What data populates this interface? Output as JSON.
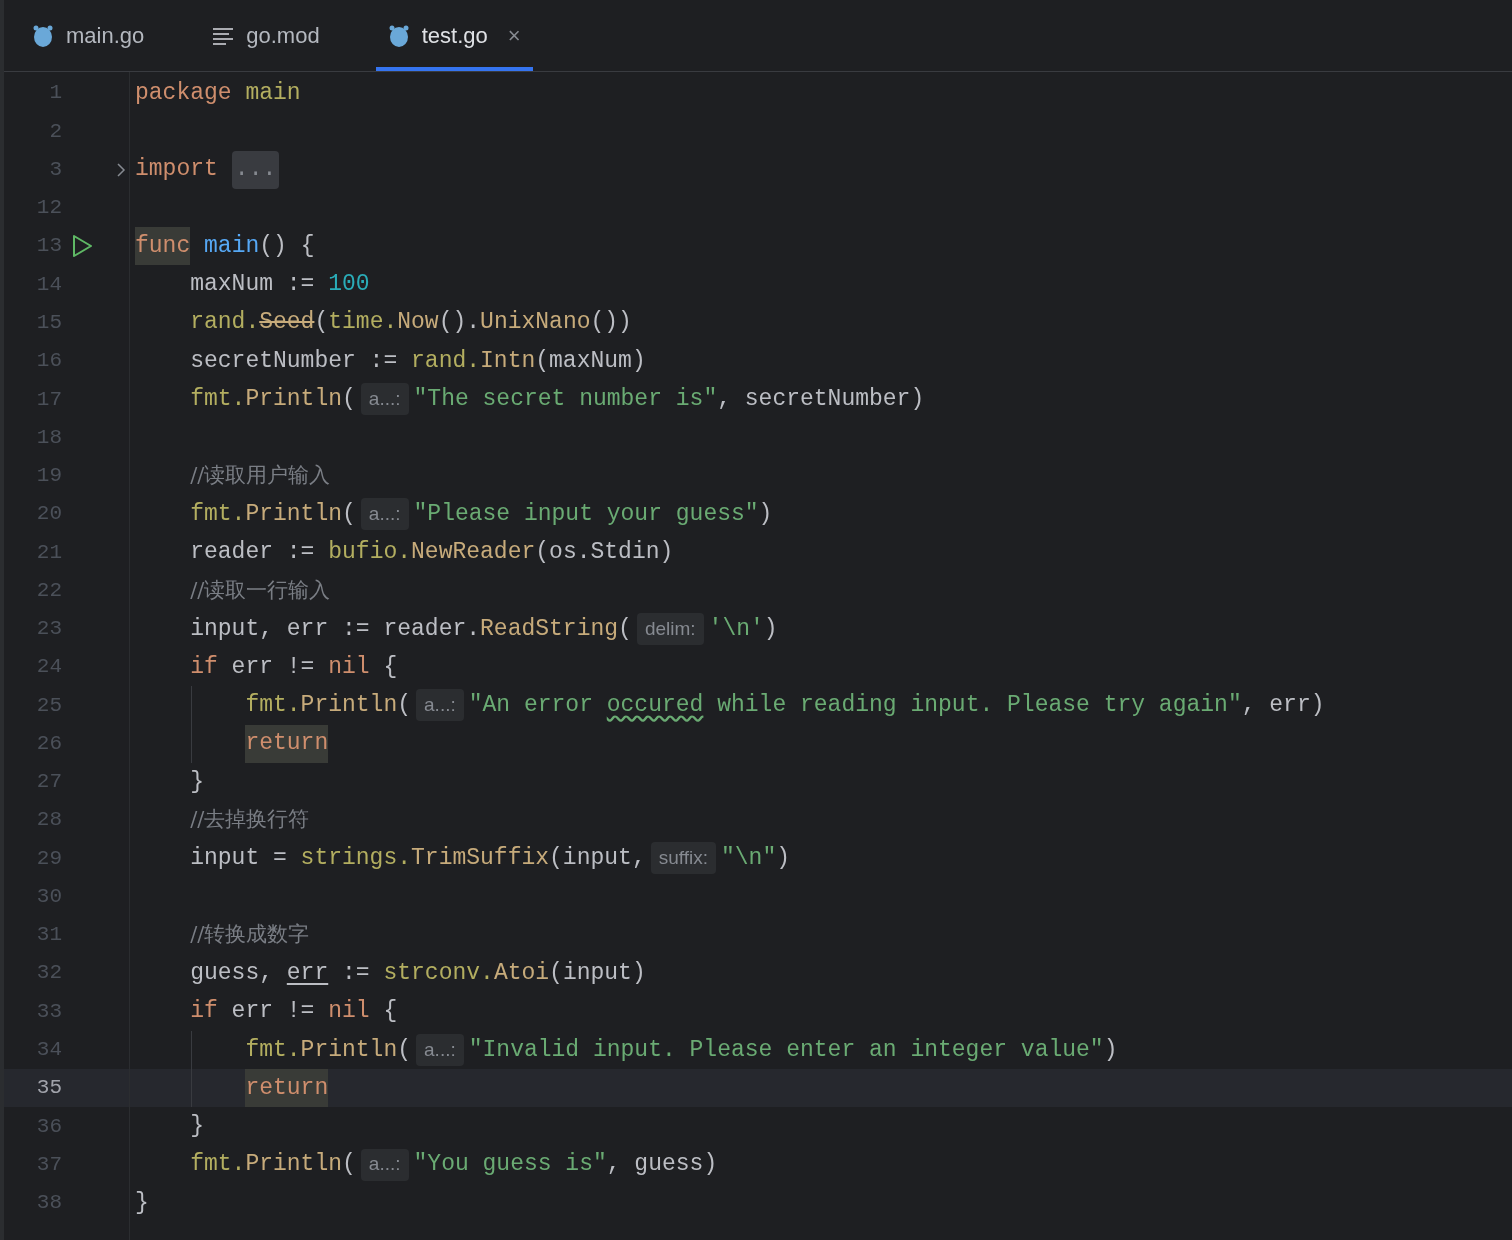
{
  "tabs": [
    {
      "label": "main.go",
      "kind": "go",
      "selected": false,
      "closable": false
    },
    {
      "label": "go.mod",
      "kind": "text",
      "selected": false,
      "closable": false
    },
    {
      "label": "test.go",
      "kind": "go",
      "selected": true,
      "closable": true,
      "close": "×"
    }
  ],
  "lines": [
    {
      "number": "1",
      "current": false,
      "folded": false,
      "runnable": false,
      "tokens": [
        {
          "kind": "keyword",
          "text": "package"
        },
        {
          "kind": "pkg",
          "text": " main"
        }
      ]
    },
    {
      "number": "2",
      "current": false,
      "folded": false,
      "runnable": false
    },
    {
      "number": "3",
      "current": false,
      "folded": true,
      "runnable": false,
      "tokens": [
        {
          "kind": "keyword",
          "text": "import"
        },
        {
          "kind": "fold",
          "text": "..."
        }
      ]
    },
    {
      "number": "12",
      "current": false,
      "folded": false,
      "runnable": false
    },
    {
      "number": "13",
      "current": false,
      "folded": false,
      "runnable": true,
      "tokens": [
        {
          "kind": "highlight",
          "text": "func"
        },
        {
          "kind": "decl",
          "text": " main"
        },
        {
          "kind": "plain",
          "text": "() {"
        }
      ],
      "children": [
        {
          "number": "14",
          "current": false,
          "folded": false,
          "runnable": false,
          "tokens": [
            {
              "kind": "plain",
              "text": "maxNum := "
            },
            {
              "kind": "number",
              "text": "100"
            }
          ]
        },
        {
          "number": "15",
          "current": false,
          "folded": false,
          "runnable": false,
          "tokens": [
            {
              "kind": "pkg",
              "text": "rand."
            },
            {
              "kind": "deprecated",
              "text": "Seed"
            },
            {
              "kind": "plain",
              "text": "("
            },
            {
              "kind": "pkg",
              "text": "time."
            },
            {
              "kind": "method",
              "text": "Now"
            },
            {
              "kind": "plain",
              "text": "()."
            },
            {
              "kind": "method",
              "text": "UnixNano"
            },
            {
              "kind": "plain",
              "text": "())"
            }
          ]
        },
        {
          "number": "16",
          "current": false,
          "folded": false,
          "runnable": false,
          "tokens": [
            {
              "kind": "plain",
              "text": "secretNumber := "
            },
            {
              "kind": "pkg",
              "text": "rand."
            },
            {
              "kind": "method",
              "text": "Intn"
            },
            {
              "kind": "plain",
              "text": "(maxNum)"
            }
          ]
        },
        {
          "number": "17",
          "current": false,
          "folded": false,
          "runnable": false,
          "tokens": [
            {
              "kind": "pkg",
              "text": "fmt."
            },
            {
              "kind": "method",
              "text": "Println"
            },
            {
              "kind": "plain",
              "text": "("
            },
            {
              "kind": "hint",
              "text": "a...:"
            },
            {
              "kind": "string",
              "text": "\"The secret number is\""
            },
            {
              "kind": "plain",
              "text": ", secretNumber)"
            }
          ]
        },
        {
          "number": "18",
          "current": false,
          "folded": false,
          "runnable": false
        },
        {
          "number": "19",
          "current": false,
          "folded": false,
          "runnable": false,
          "tokens": [
            {
              "kind": "comment",
              "text": "//读取用户输入"
            }
          ]
        },
        {
          "number": "20",
          "current": false,
          "folded": false,
          "runnable": false,
          "tokens": [
            {
              "kind": "pkg",
              "text": "fmt."
            },
            {
              "kind": "method",
              "text": "Println"
            },
            {
              "kind": "plain",
              "text": "("
            },
            {
              "kind": "hint",
              "text": "a...:"
            },
            {
              "kind": "string",
              "text": "\"Please input your guess\""
            },
            {
              "kind": "plain",
              "text": ")"
            }
          ]
        },
        {
          "number": "21",
          "current": false,
          "folded": false,
          "runnable": false,
          "tokens": [
            {
              "kind": "plain",
              "text": "reader := "
            },
            {
              "kind": "pkg",
              "text": "bufio."
            },
            {
              "kind": "method",
              "text": "NewReader"
            },
            {
              "kind": "plain",
              "text": "(os.Stdin)"
            }
          ]
        },
        {
          "number": "22",
          "current": false,
          "folded": false,
          "runnable": false,
          "tokens": [
            {
              "kind": "comment",
              "text": "//读取一行输入"
            }
          ]
        },
        {
          "number": "23",
          "current": false,
          "folded": false,
          "runnable": false,
          "tokens": [
            {
              "kind": "plain",
              "text": "input, err := reader."
            },
            {
              "kind": "method",
              "text": "ReadString"
            },
            {
              "kind": "plain",
              "text": "("
            },
            {
              "kind": "hint",
              "text": "delim:"
            },
            {
              "kind": "string",
              "text": "'\\n'"
            },
            {
              "kind": "plain",
              "text": ")"
            }
          ]
        },
        {
          "number": "24",
          "current": false,
          "folded": false,
          "runnable": false,
          "tokens": [
            {
              "kind": "keyword",
              "text": "if"
            },
            {
              "kind": "plain",
              "text": " err != "
            },
            {
              "kind": "keyword",
              "text": "nil"
            },
            {
              "kind": "plain",
              "text": " {"
            }
          ],
          "children": [
            {
              "number": "25",
              "current": false,
              "folded": false,
              "runnable": false,
              "tokens": [
                {
                  "kind": "pkg",
                  "text": "fmt."
                },
                {
                  "kind": "method",
                  "text": "Println"
                },
                {
                  "kind": "plain",
                  "text": "("
                },
                {
                  "kind": "hint",
                  "text": "a...:"
                },
                {
                  "kind": "string",
                  "text": "\"An error "
                },
                {
                  "kind": "typo",
                  "text": "occured"
                },
                {
                  "kind": "string",
                  "text": " while reading input. Please try again\""
                },
                {
                  "kind": "plain",
                  "text": ", err)"
                }
              ]
            },
            {
              "number": "26",
              "current": false,
              "folded": false,
              "runnable": false,
              "tokens": [
                {
                  "kind": "highlight",
                  "text": "return"
                }
              ]
            }
          ]
        },
        {
          "number": "27",
          "current": false,
          "folded": false,
          "runnable": false,
          "tokens": [
            {
              "kind": "plain",
              "text": "}"
            }
          ]
        },
        {
          "number": "28",
          "current": false,
          "folded": false,
          "runnable": false,
          "tokens": [
            {
              "kind": "comment",
              "text": "//去掉换行符"
            }
          ]
        },
        {
          "number": "29",
          "current": false,
          "folded": false,
          "runnable": false,
          "tokens": [
            {
              "kind": "plain",
              "text": "input = "
            },
            {
              "kind": "pkg",
              "text": "strings."
            },
            {
              "kind": "method",
              "text": "TrimSuffix"
            },
            {
              "kind": "plain",
              "text": "(input,"
            },
            {
              "kind": "hint",
              "text": "suffix:"
            },
            {
              "kind": "string",
              "text": "\"\\n\""
            },
            {
              "kind": "plain",
              "text": ")"
            }
          ]
        },
        {
          "number": "30",
          "current": false,
          "folded": false,
          "runnable": false
        },
        {
          "number": "31",
          "current": false,
          "folded": false,
          "runnable": false,
          "tokens": [
            {
              "kind": "comment",
              "text": "//转换成数字"
            }
          ]
        },
        {
          "number": "32",
          "current": false,
          "folded": false,
          "runnable": false,
          "tokens": [
            {
              "kind": "plain",
              "text": "guess, "
            },
            {
              "kind": "underlined",
              "text": "err"
            },
            {
              "kind": "plain",
              "text": " := "
            },
            {
              "kind": "pkg",
              "text": "strconv."
            },
            {
              "kind": "method",
              "text": "Atoi"
            },
            {
              "kind": "plain",
              "text": "(input)"
            }
          ]
        },
        {
          "number": "33",
          "current": false,
          "folded": false,
          "runnable": false,
          "tokens": [
            {
              "kind": "keyword",
              "text": "if"
            },
            {
              "kind": "plain",
              "text": " err != "
            },
            {
              "kind": "keyword",
              "text": "nil"
            },
            {
              "kind": "plain",
              "text": " {"
            }
          ],
          "children": [
            {
              "number": "34",
              "current": false,
              "folded": false,
              "runnable": false,
              "tokens": [
                {
                  "kind": "pkg",
                  "text": "fmt."
                },
                {
                  "kind": "method",
                  "text": "Println"
                },
                {
                  "kind": "plain",
                  "text": "("
                },
                {
                  "kind": "hint",
                  "text": "a...:"
                },
                {
                  "kind": "string",
                  "text": "\"Invalid input. Please enter an integer value\""
                },
                {
                  "kind": "plain",
                  "text": ")"
                }
              ]
            },
            {
              "number": "35",
              "current": true,
              "folded": false,
              "runnable": false,
              "tokens": [
                {
                  "kind": "highlight",
                  "text": "return"
                }
              ]
            }
          ]
        },
        {
          "number": "36",
          "current": false,
          "folded": false,
          "runnable": false,
          "tokens": [
            {
              "kind": "plain",
              "text": "}"
            }
          ]
        },
        {
          "number": "37",
          "current": false,
          "folded": false,
          "runnable": false,
          "tokens": [
            {
              "kind": "pkg",
              "text": "fmt."
            },
            {
              "kind": "method",
              "text": "Println"
            },
            {
              "kind": "plain",
              "text": "("
            },
            {
              "kind": "hint",
              "text": "a...:"
            },
            {
              "kind": "string",
              "text": "\"You guess is\""
            },
            {
              "kind": "plain",
              "text": ", guess)"
            }
          ]
        }
      ]
    },
    {
      "number": "38",
      "current": false,
      "folded": false,
      "runnable": false,
      "tokens": [
        {
          "kind": "plain",
          "text": "}"
        }
      ]
    }
  ]
}
